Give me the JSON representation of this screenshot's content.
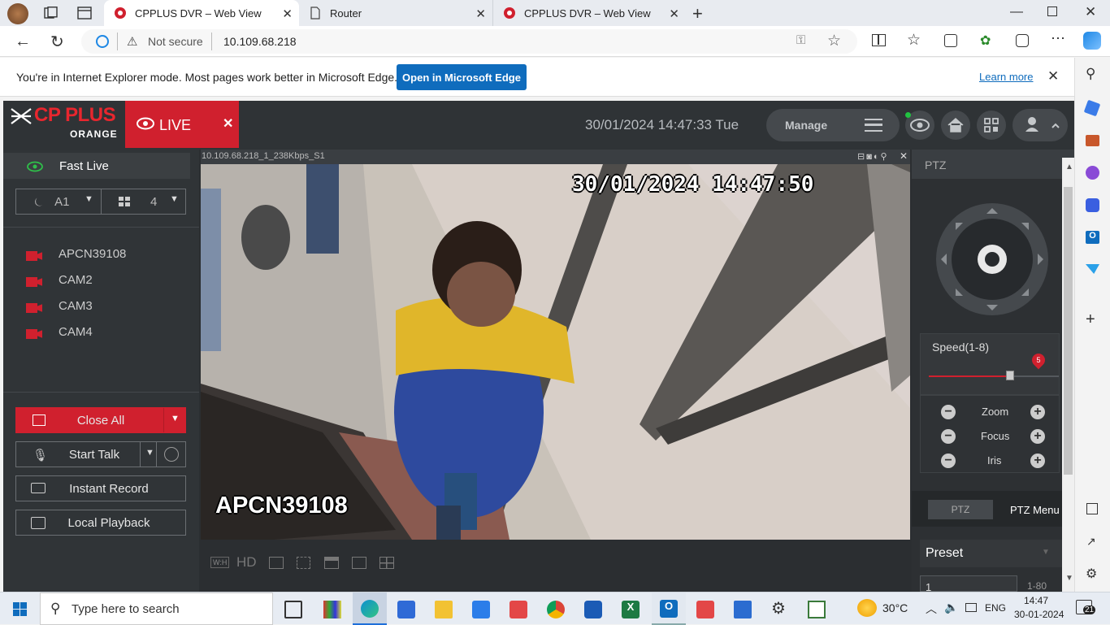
{
  "browser": {
    "tabs": [
      {
        "label": "CPPLUS DVR – Web View",
        "active": true
      },
      {
        "label": "Router",
        "active": false
      },
      {
        "label": "CPPLUS DVR – Web View",
        "active": false
      }
    ],
    "security": "Not secure",
    "url": "10.109.68.218",
    "ie_message": "You're in Internet Explorer mode. Most pages work better in Microsoft Edge.",
    "open_edge_label": "Open in Microsoft Edge",
    "learn_more": "Learn more"
  },
  "app": {
    "logo_top": "CP PLUS",
    "logo_bottom": "ORANGE",
    "live_tab": "LIVE",
    "datetime": "30/01/2024 14:47:33 Tue",
    "manage_label": "Manage",
    "sidebar": {
      "fast_live": "Fast Live",
      "stream_value": "A1",
      "layout_value": "4",
      "cameras": [
        "APCN39108",
        "CAM2",
        "CAM3",
        "CAM4"
      ],
      "close_all": "Close All",
      "start_talk": "Start Talk",
      "instant_record": "Instant Record",
      "local_playback": "Local Playback"
    },
    "video": {
      "info": "10.109.68.218_1_238Kbps_S1",
      "osd_time": "30/01/2024 14:47:50",
      "osd_name": "APCN39108"
    },
    "toolbar": {
      "wh": "W:H",
      "hd": "HD"
    },
    "ptz": {
      "title": "PTZ",
      "speed_label": "Speed(1-8)",
      "speed_value": "5",
      "speed_fraction": 0.625,
      "zoom": "Zoom",
      "focus": "Focus",
      "iris": "Iris",
      "tab_ptz": "PTZ",
      "tab_menu": "PTZ Menu",
      "preset_label": "Preset",
      "preset_input": "1",
      "preset_range": "1-80"
    },
    "colors": {
      "accent": "#d0202e",
      "bg": "#2b2e31"
    }
  },
  "taskbar": {
    "search_placeholder": "Type here to search",
    "weather": "30°C",
    "lang": "ENG",
    "time": "14:47",
    "date": "30-01-2024",
    "notif_count": "21"
  }
}
